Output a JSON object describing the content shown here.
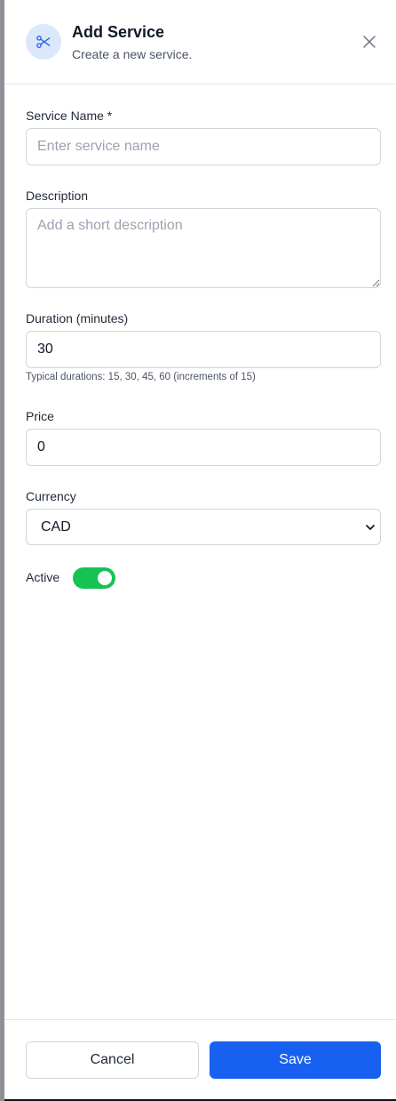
{
  "header": {
    "title": "Add Service",
    "subtitle": "Create a new service.",
    "icon": "scissors-icon",
    "close_icon": "close-icon"
  },
  "form": {
    "service_name": {
      "label": "Service Name *",
      "placeholder": "Enter service name",
      "value": ""
    },
    "description": {
      "label": "Description",
      "placeholder": "Add a short description",
      "value": ""
    },
    "duration": {
      "label": "Duration (minutes)",
      "value": "30",
      "help": "Typical durations: 15, 30, 45, 60 (increments of 15)"
    },
    "price": {
      "label": "Price",
      "value": "0"
    },
    "currency": {
      "label": "Currency",
      "value": "CAD"
    },
    "active": {
      "label": "Active",
      "on": true
    }
  },
  "footer": {
    "cancel_label": "Cancel",
    "save_label": "Save"
  },
  "colors": {
    "accent": "#1861f0",
    "toggle_on": "#17c255",
    "icon_bg": "#dbe7fb"
  }
}
